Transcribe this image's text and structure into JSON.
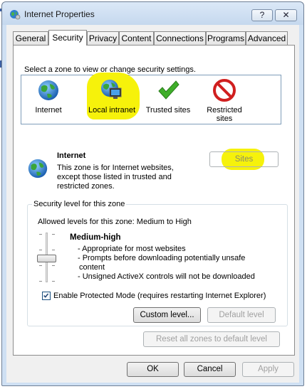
{
  "window": {
    "title": "Internet Properties",
    "help_label": "?",
    "close_label": "✕"
  },
  "tabs": [
    {
      "label": "General",
      "active": false
    },
    {
      "label": "Security",
      "active": true
    },
    {
      "label": "Privacy",
      "active": false
    },
    {
      "label": "Content",
      "active": false
    },
    {
      "label": "Connections",
      "active": false
    },
    {
      "label": "Programs",
      "active": false
    },
    {
      "label": "Advanced",
      "active": false
    }
  ],
  "security": {
    "instruction": "Select a zone to view or change security settings.",
    "zones": [
      {
        "label": "Internet",
        "icon": "globe-icon"
      },
      {
        "label": "Local intranet",
        "icon": "local-intranet-icon"
      },
      {
        "label": "Trusted sites",
        "icon": "checkmark-icon"
      },
      {
        "label_line1": "Restricted",
        "label_line2": "sites",
        "icon": "restricted-icon"
      }
    ],
    "selected_zone": {
      "name": "Internet",
      "desc_line1": "This zone is for Internet websites,",
      "desc_line2": "except those listed in trusted and",
      "desc_line3": "restricted zones."
    },
    "sites_button": "Sites",
    "level_group": {
      "legend": "Security level for this zone",
      "allowed": "Allowed levels for this zone: Medium to High",
      "level_name": "Medium-high",
      "bullets": [
        "- Appropriate for most websites",
        "- Prompts before downloading potentially unsafe",
        "content",
        "- Unsigned ActiveX controls will not be downloaded"
      ],
      "protected_mode": "Enable Protected Mode (requires restarting Internet Explorer)",
      "protected_mode_checked": true,
      "custom_level_button": "Custom level...",
      "default_level_button": "Default level"
    },
    "reset_all_button": "Reset all zones to default level"
  },
  "footer": {
    "ok": "OK",
    "cancel": "Cancel",
    "apply": "Apply"
  },
  "colors": {
    "highlight": "#f6f20b",
    "window_frame": "#cfe0f3"
  }
}
